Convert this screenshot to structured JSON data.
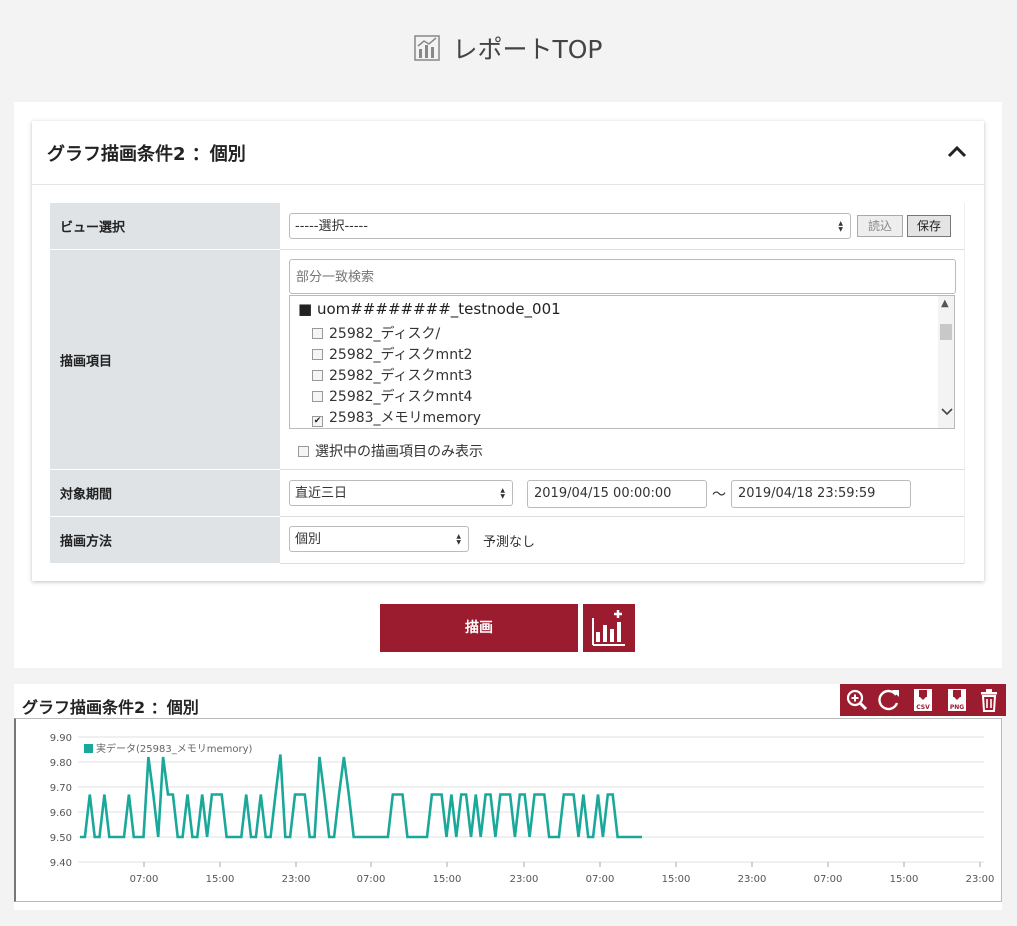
{
  "page": {
    "title": "レポートTOP"
  },
  "card": {
    "title": "グラフ描画条件2 ：個別"
  },
  "form": {
    "view_label": "ビュー選択",
    "view_value": "-----選択-----",
    "load_label": "読込",
    "save_label": "保存",
    "items_label": "描画項目",
    "search_placeholder": "部分一致検索",
    "node": "■ uom########_testnode_001",
    "items": [
      {
        "label": "25982_ディスク/",
        "checked": false
      },
      {
        "label": "25982_ディスクmnt2",
        "checked": false
      },
      {
        "label": "25982_ディスクmnt3",
        "checked": false
      },
      {
        "label": "25982_ディスクmnt4",
        "checked": false
      },
      {
        "label": "25983_メモリmemory",
        "checked": true
      }
    ],
    "selected_only_label": "選択中の描画項目のみ表示",
    "period_label": "対象期間",
    "period_value": "直近三日",
    "start": "2019/04/15 00:00:00",
    "tilde": "～",
    "end": "2019/04/18 23:59:59",
    "method_label": "描画方法",
    "method_value": "個別",
    "forecast": "予測なし"
  },
  "draw_button": "描画",
  "graph": {
    "title": "グラフ描画条件2 ：個別"
  },
  "colors": {
    "accent": "#9b1c2e",
    "series": "#1aa89a"
  },
  "chart_data": {
    "type": "line",
    "title": "",
    "xlabel": "",
    "ylabel": "",
    "ylim": [
      9.4,
      9.9
    ],
    "yticks": [
      "9.90",
      "9.80",
      "9.70",
      "9.60",
      "9.50",
      "9.40"
    ],
    "xticks": [
      "07:00",
      "15:00",
      "23:00",
      "07:00",
      "15:00",
      "23:00",
      "07:00",
      "15:00",
      "23:00",
      "07:00",
      "15:00",
      "23:00"
    ],
    "grid": true,
    "legend": "top-left",
    "series": [
      {
        "name": "実データ(25983_メモリmemory)",
        "values": [
          9.5,
          9.5,
          9.67,
          9.5,
          9.5,
          9.67,
          9.5,
          9.5,
          9.5,
          9.5,
          9.67,
          9.5,
          9.5,
          9.5,
          9.82,
          9.67,
          9.5,
          9.82,
          9.67,
          9.67,
          9.5,
          9.5,
          9.67,
          9.5,
          9.5,
          9.67,
          9.5,
          9.67,
          9.67,
          9.67,
          9.5,
          9.5,
          9.5,
          9.5,
          9.67,
          9.5,
          9.5,
          9.67,
          9.5,
          9.5,
          9.67,
          9.83,
          9.5,
          9.5,
          9.67,
          9.67,
          9.67,
          9.5,
          9.5,
          9.82,
          9.67,
          9.5,
          9.5,
          9.67,
          9.82,
          9.67,
          9.5,
          9.5,
          9.5,
          9.5,
          9.5,
          9.5,
          9.5,
          9.5,
          9.67,
          9.67,
          9.67,
          9.5,
          9.5,
          9.5,
          9.5,
          9.5,
          9.67,
          9.67,
          9.67,
          9.5,
          9.67,
          9.5,
          9.67,
          9.67,
          9.5,
          9.67,
          9.5,
          9.67,
          9.67,
          9.5,
          9.67,
          9.67,
          9.67,
          9.5,
          9.67,
          9.67,
          9.5,
          9.67,
          9.67,
          9.67,
          9.5,
          9.5,
          9.5,
          9.67,
          9.67,
          9.67,
          9.5,
          9.67,
          9.5,
          9.5,
          9.67,
          9.5,
          9.67,
          9.67,
          9.5,
          9.5,
          9.5,
          9.5,
          9.5,
          9.5
        ]
      }
    ]
  }
}
